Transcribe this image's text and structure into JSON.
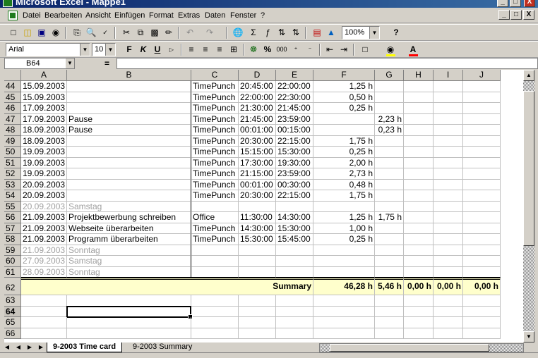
{
  "window": {
    "title": "Microsoft Excel - Mappe1",
    "controls": [
      "_",
      "□",
      "X"
    ]
  },
  "menu": {
    "items": [
      "Datei",
      "Bearbeiten",
      "Ansicht",
      "Einfügen",
      "Format",
      "Extras",
      "Daten",
      "Fenster",
      "?"
    ],
    "mdi_controls": [
      "_",
      "□",
      "X"
    ]
  },
  "toolbar": {
    "zoom": "100%",
    "font": "Arial",
    "font_size": "10",
    "bold": "F",
    "italic": "K",
    "underline": "U",
    "percent": "%",
    "thousands": "000",
    "help": "?",
    "colors": {
      "fill": "#ffff00",
      "font": "#ff0000"
    }
  },
  "formula_bar": {
    "name_box": "B64",
    "equals": "=",
    "value": ""
  },
  "columns": [
    "A",
    "B",
    "C",
    "D",
    "E",
    "F",
    "G",
    "H",
    "I",
    "J"
  ],
  "rows": [
    {
      "n": "44",
      "a": "15.09.2003",
      "b": "",
      "c": "TimePunch",
      "d": "20:45:00",
      "e": "22:00:00",
      "f": "1,25 h",
      "g": ""
    },
    {
      "n": "45",
      "a": "15.09.2003",
      "b": "",
      "c": "TimePunch",
      "d": "22:00:00",
      "e": "22:30:00",
      "f": "0,50 h",
      "g": ""
    },
    {
      "n": "46",
      "a": "17.09.2003",
      "b": "",
      "c": "TimePunch",
      "d": "21:30:00",
      "e": "21:45:00",
      "f": "0,25 h",
      "g": ""
    },
    {
      "n": "47",
      "a": "17.09.2003",
      "b": "Pause",
      "c": "TimePunch",
      "d": "21:45:00",
      "e": "23:59:00",
      "f": "",
      "g": "2,23 h"
    },
    {
      "n": "48",
      "a": "18.09.2003",
      "b": "Pause",
      "c": "TimePunch",
      "d": "00:01:00",
      "e": "00:15:00",
      "f": "",
      "g": "0,23 h"
    },
    {
      "n": "49",
      "a": "18.09.2003",
      "b": "",
      "c": "TimePunch",
      "d": "20:30:00",
      "e": "22:15:00",
      "f": "1,75 h",
      "g": ""
    },
    {
      "n": "50",
      "a": "19.09.2003",
      "b": "",
      "c": "TimePunch",
      "d": "15:15:00",
      "e": "15:30:00",
      "f": "0,25 h",
      "g": ""
    },
    {
      "n": "51",
      "a": "19.09.2003",
      "b": "",
      "c": "TimePunch",
      "d": "17:30:00",
      "e": "19:30:00",
      "f": "2,00 h",
      "g": ""
    },
    {
      "n": "52",
      "a": "19.09.2003",
      "b": "",
      "c": "TimePunch",
      "d": "21:15:00",
      "e": "23:59:00",
      "f": "2,73 h",
      "g": ""
    },
    {
      "n": "53",
      "a": "20.09.2003",
      "b": "",
      "c": "TimePunch",
      "d": "00:01:00",
      "e": "00:30:00",
      "f": "0,48 h",
      "g": ""
    },
    {
      "n": "54",
      "a": "20.09.2003",
      "b": "",
      "c": "TimePunch",
      "d": "20:30:00",
      "e": "22:15:00",
      "f": "1,75 h",
      "g": ""
    },
    {
      "n": "55",
      "a": "20.09.2003",
      "b": "Samstag",
      "c": "",
      "d": "",
      "e": "",
      "f": "",
      "g": "",
      "gray": true
    },
    {
      "n": "56",
      "a": "21.09.2003",
      "b": "Projektbewerbung schreiben",
      "c": "Office",
      "d": "11:30:00",
      "e": "14:30:00",
      "f": "1,25 h",
      "g": "1,75 h"
    },
    {
      "n": "57",
      "a": "21.09.2003",
      "b": "Webseite überarbeiten",
      "c": "TimePunch",
      "d": "14:30:00",
      "e": "15:30:00",
      "f": "1,00 h",
      "g": ""
    },
    {
      "n": "58",
      "a": "21.09.2003",
      "b": "Programm überarbeiten",
      "c": "TimePunch",
      "d": "15:30:00",
      "e": "15:45:00",
      "f": "0,25 h",
      "g": ""
    },
    {
      "n": "59",
      "a": "21.09.2003",
      "b": "Sonntag",
      "c": "",
      "d": "",
      "e": "",
      "f": "",
      "g": "",
      "gray": true
    },
    {
      "n": "60",
      "a": "27.09.2003",
      "b": "Samstag",
      "c": "",
      "d": "",
      "e": "",
      "f": "",
      "g": "",
      "gray": true
    },
    {
      "n": "61",
      "a": "28.09.2003",
      "b": "Sonntag",
      "c": "",
      "d": "",
      "e": "",
      "f": "",
      "g": "",
      "gray": true
    }
  ],
  "summary": {
    "n": "62",
    "label": "Summary",
    "f": "46,28 h",
    "g": "5,46 h",
    "h": "0,00 h",
    "i": "0,00 h",
    "j": "0,00 h"
  },
  "empty_rows": [
    "63",
    "64",
    "65",
    "66"
  ],
  "active_row": "64",
  "sheets": [
    "9-2003 Time card",
    "9-2003 Summary"
  ],
  "active_sheet": 0
}
